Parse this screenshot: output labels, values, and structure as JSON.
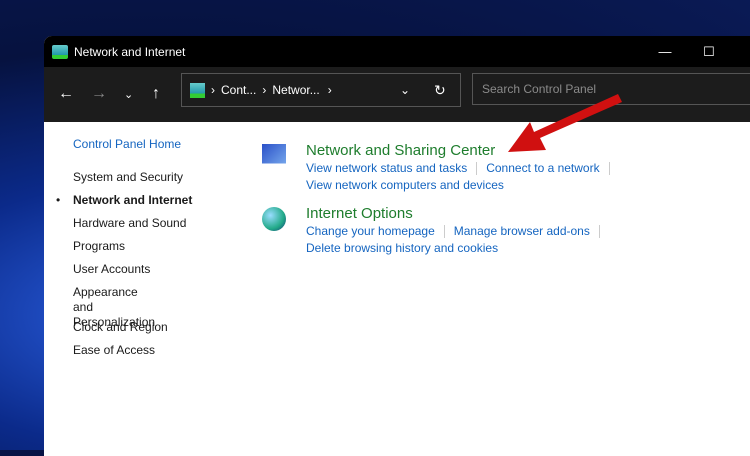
{
  "window": {
    "title": "Network and Internet"
  },
  "address": {
    "crumbs": [
      "Cont...",
      "Networ..."
    ]
  },
  "search": {
    "placeholder": "Search Control Panel"
  },
  "sidebar": {
    "home": "Control Panel Home",
    "items": [
      "System and Security",
      "Network and Internet",
      "Hardware and Sound",
      "Programs",
      "User Accounts",
      "Appearance and\nPersonalization",
      "Clock and Region",
      "Ease of Access"
    ]
  },
  "categories": [
    {
      "title": "Network and Sharing Center",
      "links": [
        "View network status and tasks",
        "Connect to a network",
        "View network computers and devices"
      ]
    },
    {
      "title": "Internet Options",
      "links": [
        "Change your homepage",
        "Manage browser add-ons",
        "Delete browsing history and cookies"
      ]
    }
  ],
  "colors": {
    "heading": "#1e7d2d",
    "link": "#1565c0",
    "arrow": "#d01010"
  }
}
